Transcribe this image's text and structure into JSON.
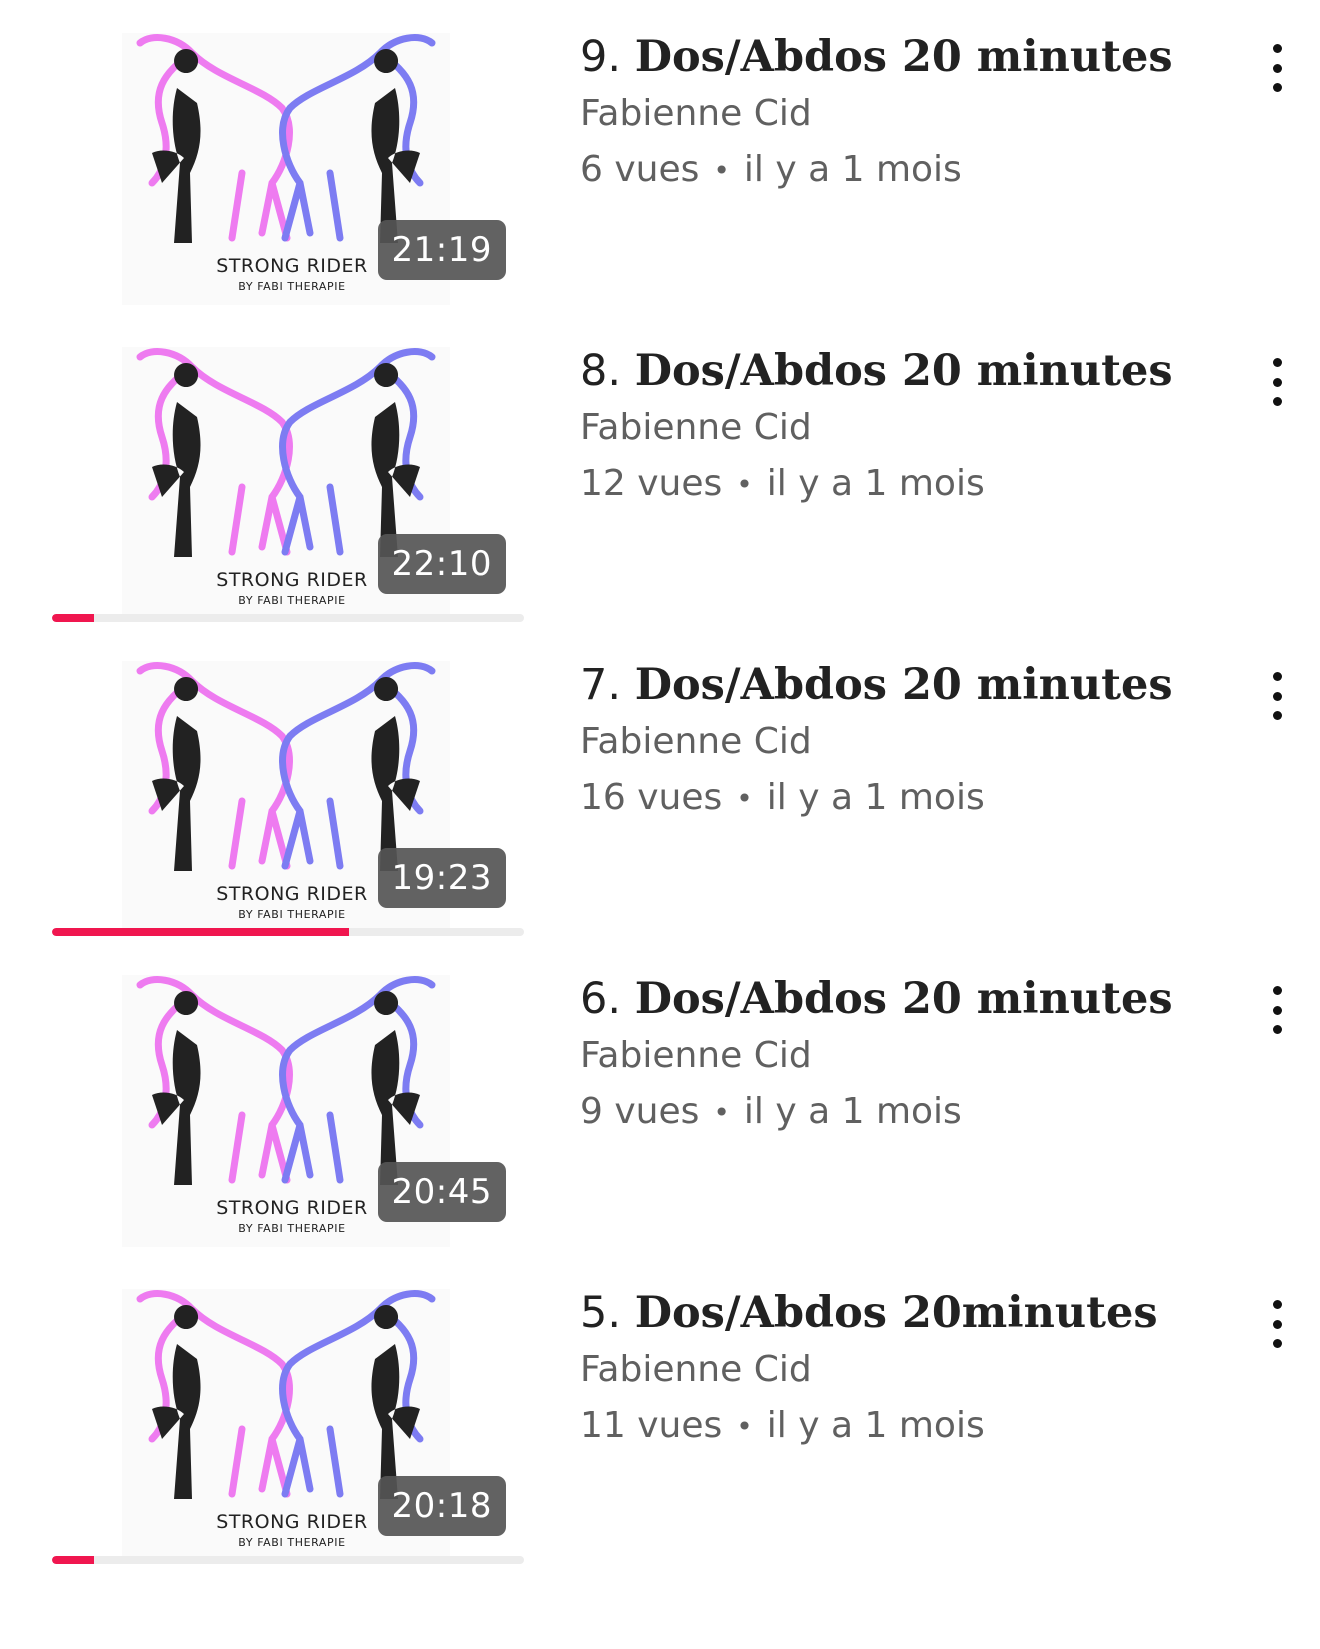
{
  "colors": {
    "accent": "#f0164f",
    "horse_pink": "#ee7bf0",
    "horse_blue": "#7d7cf2"
  },
  "videos": [
    {
      "number": "9.",
      "title": "Dos/Abdos 20 minutes",
      "channel": "Fabienne Cid",
      "views": "6 vues",
      "age": "il y a 1 mois",
      "duration": "21:19",
      "brand": "STRONG RIDER",
      "brand_sub": "BY FABI THERAPIE",
      "watched_fraction": 0
    },
    {
      "number": "8.",
      "title": "Dos/Abdos 20 minutes",
      "channel": "Fabienne Cid",
      "views": "12 vues",
      "age": "il y a 1 mois",
      "duration": "22:10",
      "brand": "STRONG RIDER",
      "brand_sub": "BY FABI THERAPIE",
      "watched_fraction": 0.09
    },
    {
      "number": "7.",
      "title": "Dos/Abdos 20 minutes",
      "channel": "Fabienne Cid",
      "views": "16 vues",
      "age": "il y a 1 mois",
      "duration": "19:23",
      "brand": "STRONG RIDER",
      "brand_sub": "BY FABI THERAPIE",
      "watched_fraction": 0.63
    },
    {
      "number": "6.",
      "title": "Dos/Abdos 20 minutes",
      "channel": "Fabienne Cid",
      "views": "9 vues",
      "age": "il y a 1 mois",
      "duration": "20:45",
      "brand": "STRONG RIDER",
      "brand_sub": "BY FABI THERAPIE",
      "watched_fraction": 0
    },
    {
      "number": "5.",
      "title": "Dos/Abdos 20minutes",
      "channel": "Fabienne Cid",
      "views": "11 vues",
      "age": "il y a 1 mois",
      "duration": "20:18",
      "brand": "STRONG RIDER",
      "brand_sub": "BY FABI THERAPIE",
      "watched_fraction": 0.09
    }
  ],
  "separator": "•",
  "menu_icon": "more-vertical-icon"
}
